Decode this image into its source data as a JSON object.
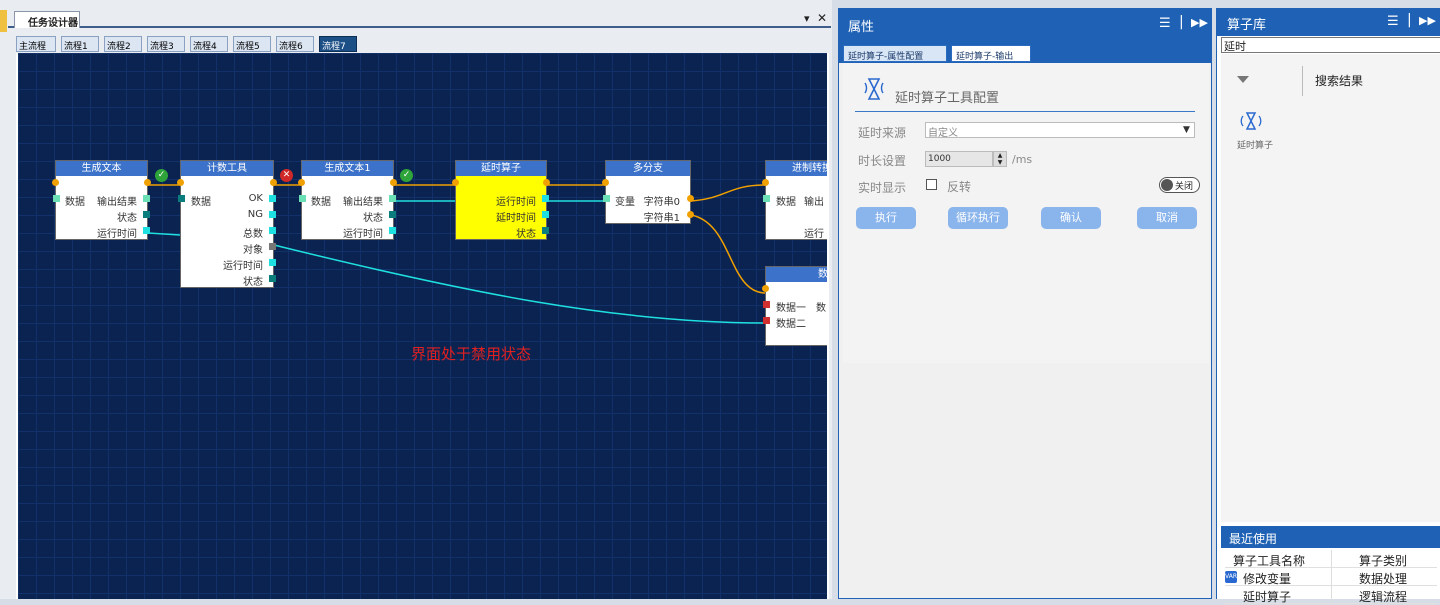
{
  "designer": {
    "tab_label": "任务设计器",
    "menu_glyph": "▾",
    "close_glyph": "✕",
    "flow_tabs": [
      "主流程",
      "流程1",
      "流程2",
      "流程3",
      "流程4",
      "流程5",
      "流程6",
      "流程7"
    ],
    "selected_flow_tab": "流程7",
    "disabled_message": "界面处于禁用状态",
    "nodes": {
      "gen_text": {
        "title": "生成文本",
        "in_data": "数据",
        "out_result": "输出结果",
        "status": "状态",
        "runtime": "运行时间"
      },
      "counter": {
        "title": "计数工具",
        "in_data": "数据",
        "ok": "OK",
        "ng": "NG",
        "total": "总数",
        "object": "对象",
        "runtime": "运行时间",
        "status": "状态"
      },
      "gen_text1": {
        "title": "生成文本1",
        "in_data": "数据",
        "out_result": "输出结果",
        "status": "状态",
        "runtime": "运行时间"
      },
      "delay": {
        "title": "延时算子",
        "runtime": "运行时间",
        "delay_time": "延时时间",
        "status": "状态"
      },
      "branch": {
        "title": "多分支",
        "var": "变量",
        "str0": "字符串0",
        "str1": "字符串1"
      },
      "convert": {
        "title": "进制转换",
        "in_data": "数据",
        "out": "输出",
        "runtime": "运行"
      },
      "data_node": {
        "title": "数",
        "data1": "数据一",
        "data1_out": "数",
        "data2": "数据二"
      }
    }
  },
  "properties": {
    "title": "属性",
    "menu_icon": "hamburger-icon",
    "pin_icon": "fast-forward-icon",
    "tabs": [
      "延时算子-属性配置",
      "延时算子-输出"
    ],
    "config_title": "延时算子工具配置",
    "source_label": "延时来源",
    "source_value": "自定义",
    "duration_label": "时长设置",
    "duration_value": "1000",
    "duration_unit": "/ms",
    "realtime_label": "实时显示",
    "invert_label": "反转",
    "toggle_label": "关闭",
    "buttons": [
      "执行",
      "循环执行",
      "确认",
      "取消"
    ]
  },
  "library": {
    "title": "算子库",
    "search_value": "延时",
    "search_results_label": "搜索结果",
    "result_tool": "延时算子",
    "recent_title": "最近使用",
    "recent_headers": [
      "算子工具名称",
      "算子类别"
    ],
    "recent_rows": [
      [
        "修改变量",
        "数据处理"
      ],
      [
        "延时算子",
        "逻辑流程"
      ]
    ]
  },
  "colors": {
    "accent": "#1f62b5",
    "canvas": "#0b2350",
    "node_header": "#3c72c9",
    "selected_node": "#ffff00",
    "wire_orange": "#f0a000",
    "wire_cyan": "#1fe0e0",
    "disabled_text": "#e02020",
    "button": "#8ab4ec"
  }
}
